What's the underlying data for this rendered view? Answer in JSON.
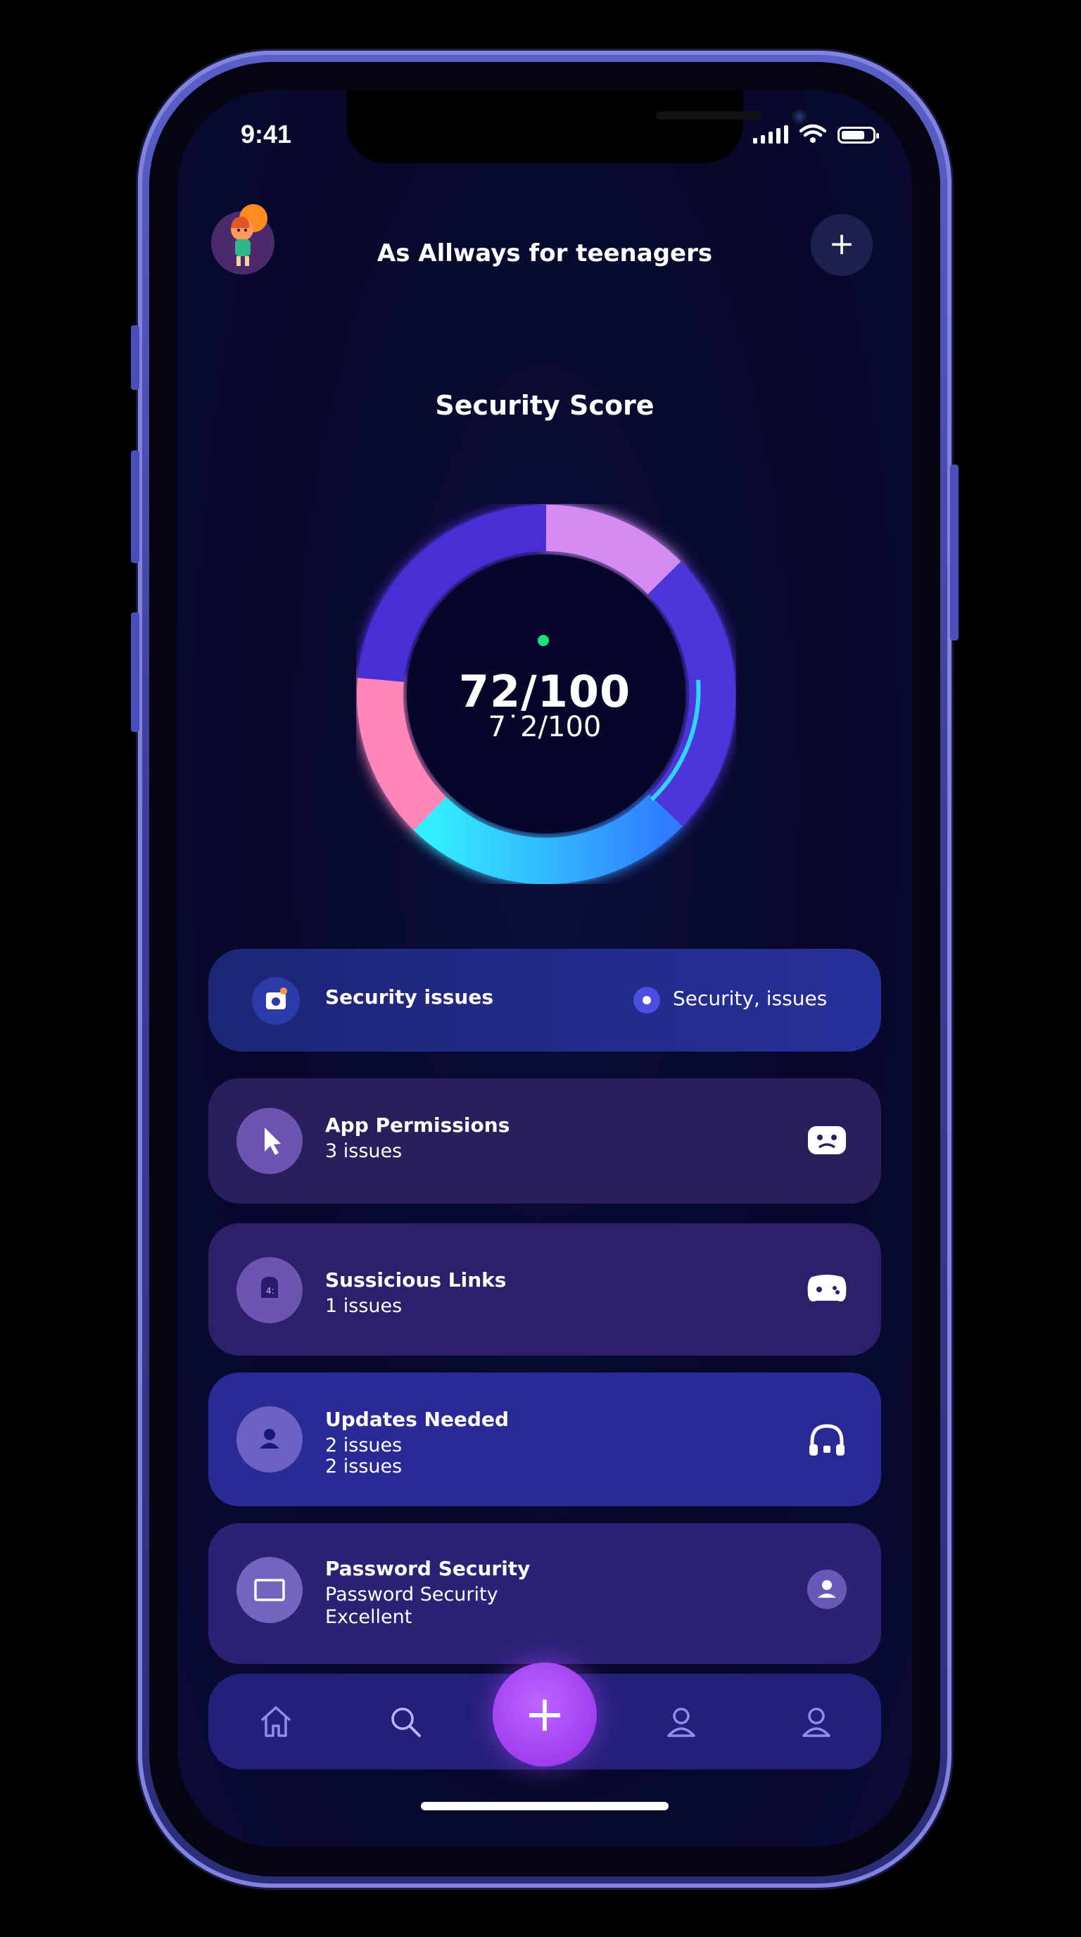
{
  "status_bar": {
    "time": "9:41"
  },
  "header": {
    "title": "As Allways for teenagers",
    "add_label": "+"
  },
  "score": {
    "section_title": "Security Score",
    "main_text": "72/100",
    "sub_text": "7˙2/100",
    "value": 72,
    "max": 100
  },
  "banner": {
    "label": "Security issues",
    "right_label": "Security, issues"
  },
  "cards": [
    {
      "title": "App Permissions",
      "lines": [
        "3 issues"
      ],
      "icon": "cursor-icon",
      "right_icon": "sad-face-icon",
      "color": "#2a1e5c"
    },
    {
      "title": "Sussicious Links",
      "lines": [
        "1 issues"
      ],
      "icon": "lock-icon",
      "right_icon": "gamepad-icon",
      "color": "#2e1f6a"
    },
    {
      "title": "Updates Needed",
      "lines": [
        "2 issues",
        "2 issues"
      ],
      "icon": "user-icon",
      "right_icon": "headphones-icon",
      "color": "#2a2a96"
    },
    {
      "title": "Password Security",
      "lines": [
        "Password Security",
        "Excellent"
      ],
      "icon": "laptop-icon",
      "right_icon": "user-badge-icon",
      "color": "#2b2276"
    }
  ],
  "nav": {
    "fab_label": "+",
    "items": [
      "home-icon",
      "search-icon",
      "profile-icon",
      "account-icon"
    ]
  },
  "colors": {
    "ring_purple": "#4b2fd8",
    "ring_lilac": "#d68cf0",
    "ring_pink": "#ff86b8",
    "ring_cyan": "#2ee8ff",
    "ring_blue": "#2f6cff",
    "score_dot": "#1de08a",
    "fab": "#a03ef0"
  }
}
